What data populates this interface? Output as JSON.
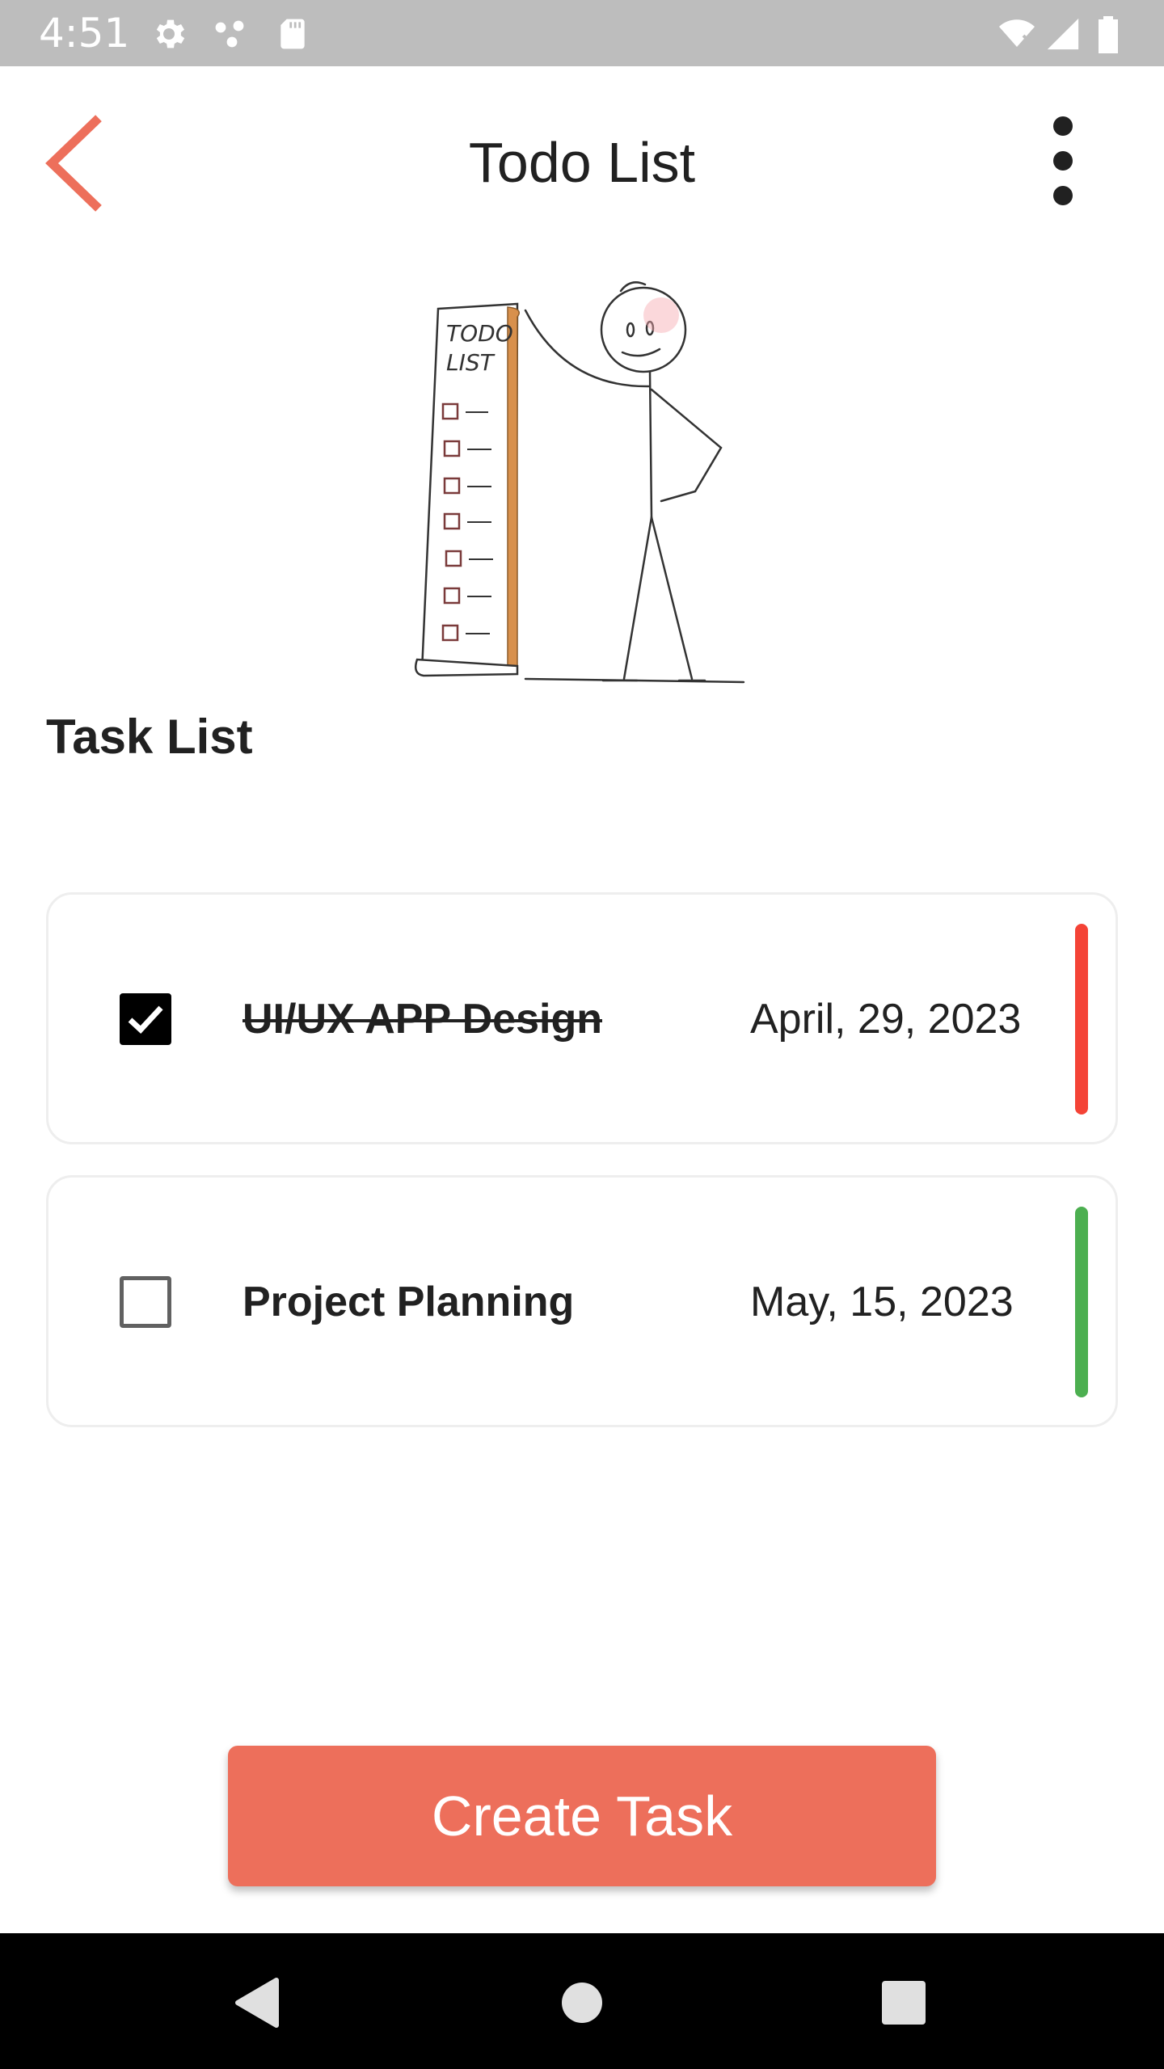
{
  "status_bar": {
    "time": "4:51",
    "icons": [
      "settings-icon",
      "nodes-icon",
      "sd-card-icon",
      "wifi-icon",
      "signal-icon",
      "battery-icon"
    ]
  },
  "app_bar": {
    "title": "Todo List",
    "back_icon": "chevron-left-icon",
    "menu_icon": "more-vert-icon"
  },
  "illustration": {
    "name": "stick-figure-todo-list-illustration",
    "scroll_heading": "TODO LIST"
  },
  "section": {
    "title": "Task List"
  },
  "tasks": [
    {
      "title": "UI/UX APP Design",
      "date": "April, 29, 2023",
      "completed": true,
      "priority_color": "#f44336"
    },
    {
      "title": "Project Planning",
      "date": "May, 15, 2023",
      "completed": false,
      "priority_color": "#4caf50"
    }
  ],
  "create_button": {
    "label": "Create Task"
  },
  "colors": {
    "accent": "#ed6f5b",
    "status_bar": "#bdbdbd",
    "nav_bar": "#000000"
  },
  "nav_bar": {
    "buttons": [
      "back-triangle-icon",
      "home-circle-icon",
      "recents-square-icon"
    ]
  }
}
